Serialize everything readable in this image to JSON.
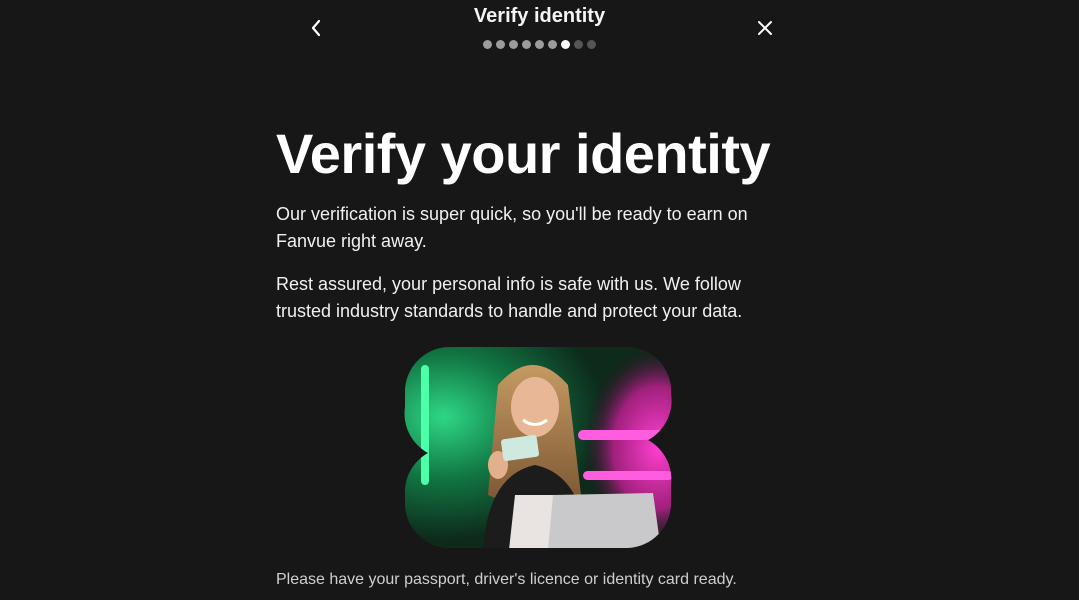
{
  "header": {
    "title": "Verify identity",
    "progress": {
      "total_steps": 9,
      "current_step": 7
    }
  },
  "main": {
    "title": "Verify your identity",
    "paragraphs": [
      "Our verification is super quick, so you'll be ready to earn on Fanvue right away.",
      "Rest assured, your personal info is safe with us. We follow trusted industry standards to handle and protect your data."
    ],
    "footnote": "Please have your passport, driver's licence or identity card ready."
  },
  "icons": {
    "back": "chevron-left-icon",
    "close": "close-icon"
  },
  "colors": {
    "background": "#171717",
    "text": "#ffffff",
    "neon_green": "#1fd07a",
    "neon_pink": "#ff2fc6"
  }
}
